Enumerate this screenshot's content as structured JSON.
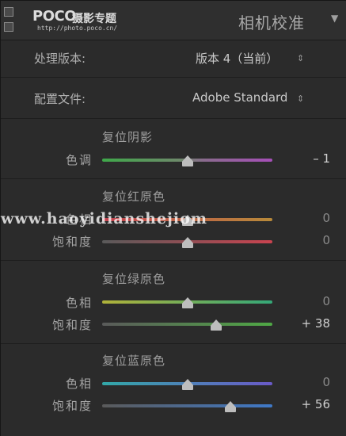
{
  "header": {
    "logo_word": "POCO",
    "logo_cn": "摄影专题",
    "logo_url": "http://photo.poco.cn/",
    "title": "相机校准",
    "collapse_icon": "triangle-down-icon"
  },
  "process": {
    "label": "处理版本:",
    "value": "版本 4（当前）"
  },
  "profile": {
    "label": "配置文件:",
    "value": "Adobe Standard"
  },
  "shadows": {
    "title": "复位阴影",
    "tint": {
      "label": "色调",
      "value_text": "– 1",
      "value": -1
    }
  },
  "red": {
    "title": "复位红原色",
    "hue": {
      "label": "色相",
      "value_text": "0",
      "value": 0
    },
    "saturation": {
      "label": "饱和度",
      "value_text": "0",
      "value": 0
    }
  },
  "green": {
    "title": "复位绿原色",
    "hue": {
      "label": "色相",
      "value_text": "0",
      "value": 0
    },
    "saturation": {
      "label": "饱和度",
      "value_text": "+ 38",
      "value": 38
    }
  },
  "blue": {
    "title": "复位蓝原色",
    "hue": {
      "label": "色相",
      "value_text": "0",
      "value": 0
    },
    "saturation": {
      "label": "饱和度",
      "value_text": "+ 56",
      "value": 56
    }
  },
  "watermark": "www.haoyidianshejiom",
  "colors": {
    "panel_bg": "#2b2b2b",
    "tint_track": [
      "#3fa84a",
      "#7a7a7a",
      "#a64fb8"
    ],
    "red_hue_track": [
      "#c2414f",
      "#b88a3a"
    ],
    "red_sat_track": [
      "#5a5a5a",
      "#c9434f"
    ],
    "green_hue_track": [
      "#b0b23a",
      "#35a878"
    ],
    "green_sat_track": [
      "#5a5a5a",
      "#4fa845"
    ],
    "blue_hue_track": [
      "#32a8a8",
      "#6a5ac8"
    ],
    "blue_sat_track": [
      "#5a5a5a",
      "#3f79c8"
    ]
  }
}
